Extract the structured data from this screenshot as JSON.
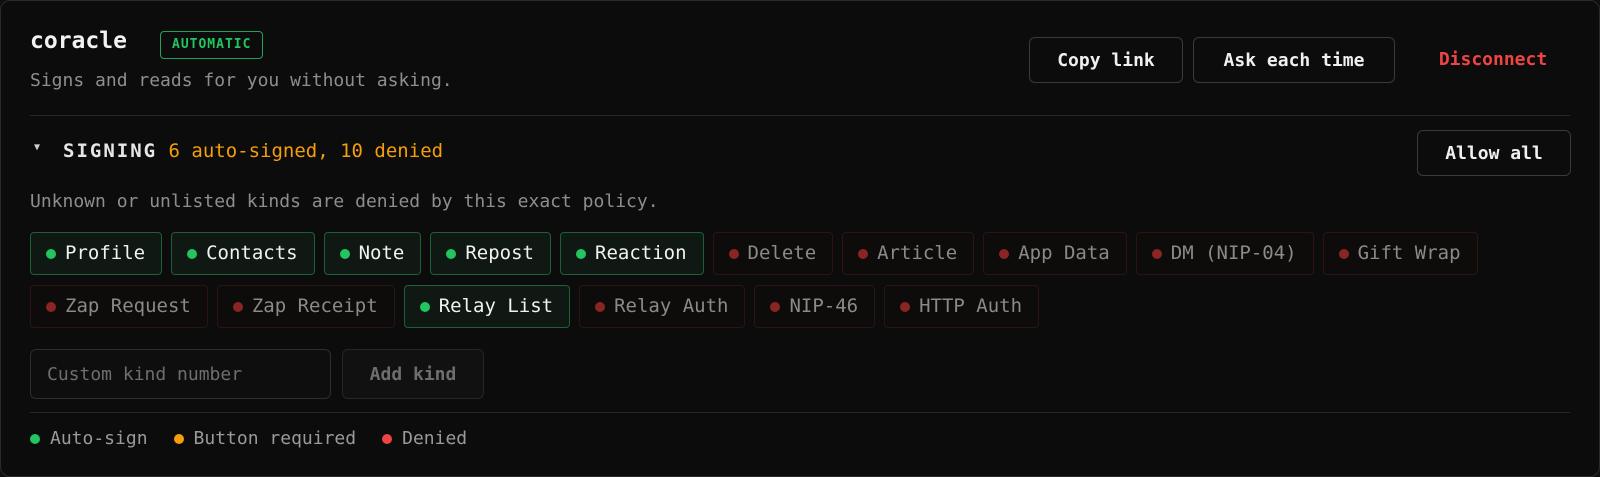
{
  "connection": {
    "name": "coracle",
    "mode_badge": "AUTOMATIC",
    "description": "Signs and reads for you without asking."
  },
  "actions": {
    "copy_link": "Copy link",
    "ask_each_time": "Ask each time",
    "disconnect": "Disconnect"
  },
  "signing": {
    "title": "SIGNING",
    "summary": "6 auto-signed, 10 denied",
    "allow_all": "Allow all",
    "note": "Unknown or unlisted kinds are denied by this exact policy.",
    "kinds": [
      {
        "label": "Profile",
        "status": "allow"
      },
      {
        "label": "Contacts",
        "status": "allow"
      },
      {
        "label": "Note",
        "status": "allow"
      },
      {
        "label": "Repost",
        "status": "allow"
      },
      {
        "label": "Reaction",
        "status": "allow"
      },
      {
        "label": "Delete",
        "status": "deny"
      },
      {
        "label": "Article",
        "status": "deny"
      },
      {
        "label": "App Data",
        "status": "deny"
      },
      {
        "label": "DM (NIP-04)",
        "status": "deny"
      },
      {
        "label": "Gift Wrap",
        "status": "deny"
      },
      {
        "label": "Zap Request",
        "status": "deny"
      },
      {
        "label": "Zap Receipt",
        "status": "deny"
      },
      {
        "label": "Relay List",
        "status": "allow"
      },
      {
        "label": "Relay Auth",
        "status": "deny"
      },
      {
        "label": "NIP-46",
        "status": "deny"
      },
      {
        "label": "HTTP Auth",
        "status": "deny"
      }
    ],
    "custom_kind_placeholder": "Custom kind number",
    "add_kind": "Add kind"
  },
  "legend": [
    {
      "label": "Auto-sign",
      "color": "#22c55e"
    },
    {
      "label": "Button required",
      "color": "#f59e0b"
    },
    {
      "label": "Denied",
      "color": "#ef4444"
    }
  ],
  "colors": {
    "accent_green": "#22c55e",
    "warning_amber": "#f59e0b",
    "danger_red": "#ef4444"
  }
}
